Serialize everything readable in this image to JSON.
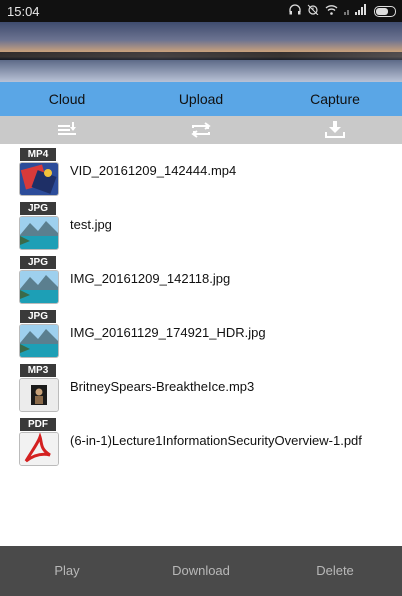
{
  "status_bar": {
    "time": "15:04",
    "icons": [
      "headphones-icon",
      "alarm-icon",
      "wifi-icon",
      "signal-icon",
      "battery-icon"
    ]
  },
  "tabs": [
    {
      "label": "Cloud"
    },
    {
      "label": "Upload"
    },
    {
      "label": "Capture"
    }
  ],
  "toolbar": {
    "icons": [
      "sort-list-icon",
      "repeat-icon",
      "download-icon"
    ]
  },
  "files": [
    {
      "type": "MP4",
      "name": "VID_20161209_142444.mp4",
      "icon": "video-file-icon"
    },
    {
      "type": "JPG",
      "name": "test.jpg",
      "icon": "image-file-icon"
    },
    {
      "type": "JPG",
      "name": "IMG_20161209_142118.jpg",
      "icon": "image-file-icon"
    },
    {
      "type": "JPG",
      "name": "IMG_20161129_174921_HDR.jpg",
      "icon": "image-file-icon"
    },
    {
      "type": "MP3",
      "name": "BritneySpears-BreaktheIce.mp3",
      "icon": "audio-file-icon"
    },
    {
      "type": "PDF",
      "name": "(6-in-1)Lecture1InformationSecurityOverview-1.pdf",
      "icon": "pdf-file-icon"
    }
  ],
  "bottom_bar": {
    "play_label": "Play",
    "download_label": "Download",
    "delete_label": "Delete"
  },
  "colors": {
    "tab_bar": "#5aa6e6",
    "toolbar": "#c9c9c9",
    "bottom_bar": "#4a4a4a",
    "status_bar": "#111111"
  }
}
